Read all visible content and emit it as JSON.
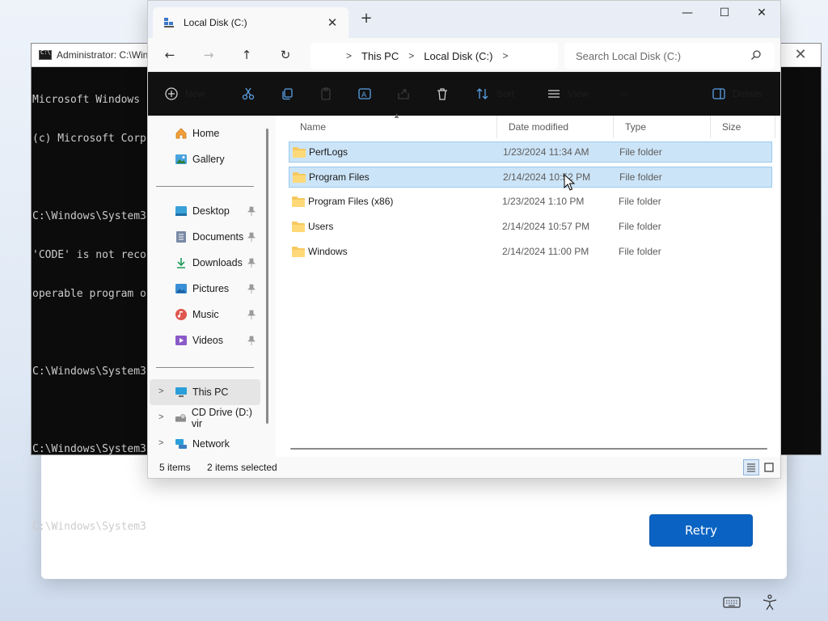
{
  "setup": {
    "retry_label": "Retry"
  },
  "cmd": {
    "title": "Administrator: C:\\Win",
    "lines": [
      "Microsoft Windows",
      "(c) Microsoft Corp",
      "",
      "C:\\Windows\\System3",
      "'CODE' is not reco",
      "operable program o",
      "",
      "C:\\Windows\\System3",
      "",
      "C:\\Windows\\System3",
      "",
      "C:\\Windows\\System3"
    ]
  },
  "explorer": {
    "tab_title": "Local Disk (C:)",
    "breadcrumb": [
      "This PC",
      "Local Disk (C:)"
    ],
    "search_placeholder": "Search Local Disk (C:)",
    "toolbar": {
      "new_label": "New",
      "sort_label": "Sort",
      "view_label": "View",
      "details_label": "Details"
    },
    "nav": {
      "home": "Home",
      "gallery": "Gallery",
      "desktop": "Desktop",
      "documents": "Documents",
      "downloads": "Downloads",
      "pictures": "Pictures",
      "music": "Music",
      "videos": "Videos",
      "this_pc": "This PC",
      "cd_drive": "CD Drive (D:) vir",
      "network": "Network"
    },
    "columns": {
      "name": "Name",
      "date": "Date modified",
      "type": "Type",
      "size": "Size"
    },
    "files": [
      {
        "name": "PerfLogs",
        "date": "1/23/2024 11:34 AM",
        "type": "File folder"
      },
      {
        "name": "Program Files",
        "date": "2/14/2024 10:52 PM",
        "type": "File folder"
      },
      {
        "name": "Program Files (x86)",
        "date": "1/23/2024 1:10 PM",
        "type": "File folder"
      },
      {
        "name": "Users",
        "date": "2/14/2024 10:57 PM",
        "type": "File folder"
      },
      {
        "name": "Windows",
        "date": "2/14/2024 11:00 PM",
        "type": "File folder"
      }
    ],
    "status": {
      "count": "5 items",
      "selected": "2 items selected"
    }
  },
  "colors": {
    "accent": "#0a63c2",
    "selection": "#cce4f7",
    "folder": "#f6c85f"
  }
}
